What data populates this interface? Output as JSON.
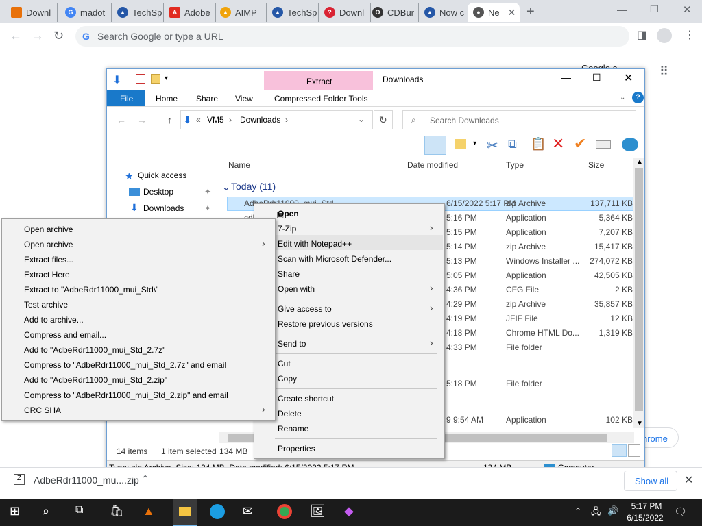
{
  "browser": {
    "tabs": [
      {
        "label": "Downl",
        "icon": "vlc-icon",
        "color": "#e8710a"
      },
      {
        "label": "madot",
        "icon": "google-icon",
        "color": "#4285f4"
      },
      {
        "label": "TechSp",
        "icon": "techspot-icon",
        "color": "#2557a7"
      },
      {
        "label": "Adobe",
        "icon": "adobe-icon",
        "color": "#e12b20"
      },
      {
        "label": "AIMP",
        "icon": "aimp-icon",
        "color": "#f0a30a"
      },
      {
        "label": "TechSp",
        "icon": "techspot-icon",
        "color": "#2557a7"
      },
      {
        "label": "Downl",
        "icon": "opera-icon",
        "color": "#d92333"
      },
      {
        "label": "CDBur",
        "icon": "cdburner-icon",
        "color": "#333333"
      },
      {
        "label": "Now c",
        "icon": "techspot-icon",
        "color": "#2557a7"
      },
      {
        "label": "Ne",
        "icon": "chrome-icon",
        "color": "#555555"
      }
    ],
    "omnibox_placeholder": "Search Google or type a URL"
  },
  "page": {
    "partial_text": "Google a",
    "chrome_btn": "hrome"
  },
  "explorer": {
    "title": "Downloads",
    "extract_tab": "Extract",
    "compressed_tools": "Compressed Folder Tools",
    "ribbon_tabs": [
      "File",
      "Home",
      "Share",
      "View"
    ],
    "breadcrumb": [
      "VM5",
      "Downloads"
    ],
    "search_placeholder": "Search Downloads",
    "columns": [
      "Name",
      "Date modified",
      "Type",
      "Size"
    ],
    "group_label": "Today (11)",
    "nav": [
      "Quick access",
      "Desktop",
      "Downloads"
    ],
    "rows": [
      {
        "name": "AdbeRdr11000_mui_Std",
        "date": "6/15/2022 5:17 PM",
        "type": "zip Archive",
        "size": "137,711 KB"
      },
      {
        "name": "cdbxp",
        "date": "5:16 PM",
        "type": "Application",
        "size": "5,364 KB"
      },
      {
        "name": "",
        "date": "5:15 PM",
        "type": "Application",
        "size": "7,207 KB"
      },
      {
        "name": "",
        "date": "5:14 PM",
        "type": "zip Archive",
        "size": "15,417 KB"
      },
      {
        "name": "",
        "date": "5:13 PM",
        "type": "Windows Installer ...",
        "size": "274,072 KB"
      },
      {
        "name": "",
        "date": "5:05 PM",
        "type": "Application",
        "size": "42,505 KB"
      },
      {
        "name": "",
        "date": "4:36 PM",
        "type": "CFG File",
        "size": "2 KB"
      },
      {
        "name": "",
        "date": "4:29 PM",
        "type": "zip Archive",
        "size": "35,857 KB"
      },
      {
        "name": "",
        "date": "4:19 PM",
        "type": "JFIF File",
        "size": "12 KB"
      },
      {
        "name": "",
        "date": "4:18 PM",
        "type": "Chrome HTML Do...",
        "size": "1,319 KB"
      },
      {
        "name": "",
        "date": "4:33 PM",
        "type": "File folder",
        "size": ""
      },
      {
        "name": "",
        "date": "5:18 PM",
        "type": "File folder",
        "size": ""
      },
      {
        "name": "",
        "date": "9 9:54 AM",
        "type": "Application",
        "size": "102 KB"
      }
    ],
    "status_items": "14 items",
    "status_selected": "1 item selected",
    "status_size": "134 MB",
    "details": "Type: zip Archive, Size: 134 MB, Date modified: 6/15/2022 5:17 PM",
    "details_size": "134 MB",
    "details_location": "Computer"
  },
  "context_menu": {
    "items": [
      {
        "label": "Open",
        "bold": true
      },
      {
        "label": "7-Zip",
        "sub": true
      },
      {
        "label": "Edit with Notepad++"
      },
      {
        "label": "Scan with Microsoft Defender..."
      },
      {
        "label": "Share"
      },
      {
        "label": "Open with",
        "sub": true
      },
      {
        "label": "Give access to",
        "sub": true
      },
      {
        "label": "Restore previous versions"
      },
      {
        "label": "Send to",
        "sub": true
      },
      {
        "label": "Cut"
      },
      {
        "label": "Copy"
      },
      {
        "label": "Create shortcut"
      },
      {
        "label": "Delete"
      },
      {
        "label": "Rename"
      },
      {
        "label": "Properties"
      }
    ]
  },
  "submenu": {
    "items": [
      "Open archive",
      "Open archive",
      "Extract files...",
      "Extract Here",
      "Extract to \"AdbeRdr11000_mui_Std\\\"",
      "Test archive",
      "Add to archive...",
      "Compress and email...",
      "Add to \"AdbeRdr11000_mui_Std_2.7z\"",
      "Compress to \"AdbeRdr11000_mui_Std_2.7z\" and email",
      "Add to \"AdbeRdr11000_mui_Std_2.zip\"",
      "Compress to \"AdbeRdr11000_mui_Std_2.zip\" and email",
      "CRC SHA"
    ]
  },
  "download": {
    "filename": "AdbeRdr11000_mu....zip",
    "show_all": "Show all"
  },
  "taskbar": {
    "time": "5:17 PM",
    "date": "6/15/2022"
  }
}
